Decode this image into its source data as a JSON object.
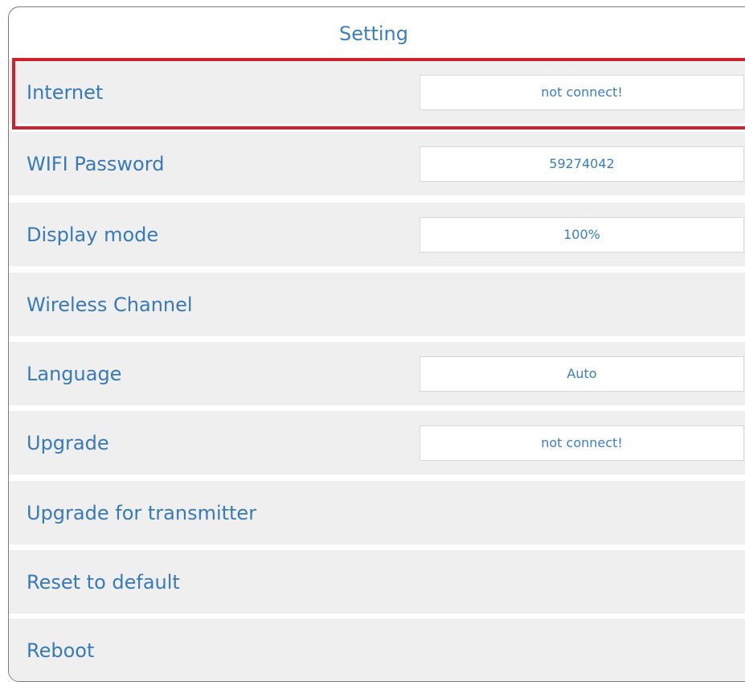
{
  "header": {
    "title": "Setting"
  },
  "rows": [
    {
      "label": "Internet",
      "value": "not connect!"
    },
    {
      "label": "WIFI Password",
      "value": "59274042"
    },
    {
      "label": "Display mode",
      "value": "100%"
    },
    {
      "label": "Wireless Channel",
      "value": null
    },
    {
      "label": "Language",
      "value": "Auto"
    },
    {
      "label": "Upgrade",
      "value": "not connect!"
    },
    {
      "label": "Upgrade for transmitter",
      "value": null
    },
    {
      "label": "Reset to default",
      "value": null
    },
    {
      "label": "Reboot",
      "value": null
    }
  ],
  "colors": {
    "accent_text": "#3779b9",
    "row_background": "#efefef",
    "highlight_border": "#d0202e"
  }
}
